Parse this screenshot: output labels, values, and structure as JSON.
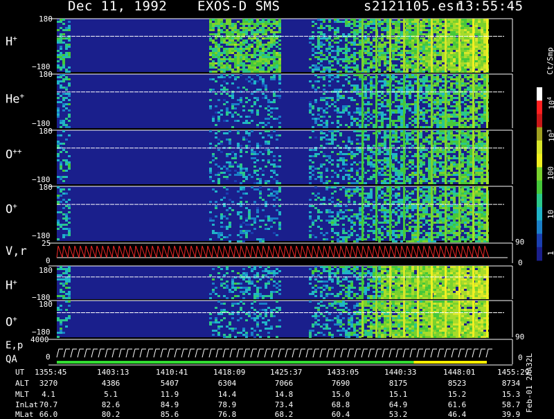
{
  "header": {
    "date": "Dec 11, 1992",
    "instrument": "EXOS-D SMS",
    "file": "s2121105.esr",
    "time": "13:55:45"
  },
  "colors": {
    "background": "#000000",
    "spectrogram_base": "#1a1f8c",
    "trace_line": "#ffffff",
    "velocity_line": "#ff2a2a",
    "qa_green": "#33dd33",
    "qa_yellow": "#ffee00"
  },
  "panels": [
    {
      "label_base": "H",
      "label_sup": "+",
      "ymax": "180",
      "ymin": "−180"
    },
    {
      "label_base": "He",
      "label_sup": "+",
      "ymax": "180",
      "ymin": "−180"
    },
    {
      "label_base": "O",
      "label_sup": "++",
      "ymax": "180",
      "ymin": "−180"
    },
    {
      "label_base": "O",
      "label_sup": "+",
      "ymax": "180",
      "ymin": "−180"
    },
    {
      "label_base": "V",
      "label_sup": "",
      "label_suffix": ",r",
      "ymax": "25",
      "ymin": "0",
      "right_top": "90",
      "right_bottom": "0"
    },
    {
      "label_base": "H",
      "label_sup": "+",
      "ymax": "180",
      "ymin": "−180"
    },
    {
      "label_base": "O",
      "label_sup": "+",
      "ymax": "180",
      "ymin": "−180",
      "right_bottom": "90"
    },
    {
      "label_base": "E,p",
      "label_line2": "QA",
      "ymax": "4000",
      "ymin": "0",
      "right_bottom": "0"
    }
  ],
  "colorbar": {
    "unit": "Ct/Smp",
    "labels": [
      "10",
      "10",
      "100",
      "10",
      "1"
    ],
    "exponents": [
      "4",
      "3",
      "",
      "",
      ""
    ]
  },
  "footer": {
    "row_labels": [
      "UT",
      "ALT",
      "MLT",
      "InLat",
      "MLat"
    ],
    "columns": [
      {
        "UT": "1355:45",
        "ALT": "3270",
        "MLT": "4.1",
        "InLat": "70.7",
        "MLat": "66.0"
      },
      {
        "UT": "1403:13",
        "ALT": "4386",
        "MLT": "5.1",
        "InLat": "82.6",
        "MLat": "80.2"
      },
      {
        "UT": "1410:41",
        "ALT": "5407",
        "MLT": "11.9",
        "InLat": "84.9",
        "MLat": "85.6"
      },
      {
        "UT": "1418:09",
        "ALT": "6304",
        "MLT": "14.4",
        "InLat": "78.9",
        "MLat": "76.8"
      },
      {
        "UT": "1425:37",
        "ALT": "7066",
        "MLT": "14.8",
        "InLat": "73.4",
        "MLat": "68.2"
      },
      {
        "UT": "1433:05",
        "ALT": "7690",
        "MLT": "15.0",
        "InLat": "68.8",
        "MLat": "60.4"
      },
      {
        "UT": "1440:33",
        "ALT": "8175",
        "MLT": "15.1",
        "InLat": "64.9",
        "MLat": "53.2"
      },
      {
        "UT": "1448:01",
        "ALT": "8523",
        "MLT": "15.2",
        "InLat": "61.6",
        "MLat": "46.4"
      },
      {
        "UT": "1455:29",
        "ALT": "8734",
        "MLT": "15.3",
        "InLat": "58.7",
        "MLat": "39.9"
      }
    ],
    "side_note": "Feb-01 2AA32L"
  },
  "chart_data": {
    "type": "heatmap",
    "title": "Dec 11, 1992   EXOS-D SMS",
    "x": [
      "1355:45",
      "1403:13",
      "1410:41",
      "1418:09",
      "1425:37",
      "1433:05",
      "1440:33",
      "1448:01",
      "1455:29"
    ],
    "xlabel": "UT",
    "series": [
      {
        "name": "H+",
        "ylim": [
          -180,
          180
        ]
      },
      {
        "name": "He+",
        "ylim": [
          -180,
          180
        ]
      },
      {
        "name": "O++",
        "ylim": [
          -180,
          180
        ]
      },
      {
        "name": "O+",
        "ylim": [
          -180,
          180
        ]
      },
      {
        "name": "V,r",
        "ylim": [
          0,
          25
        ]
      },
      {
        "name": "H+",
        "ylim": [
          -180,
          180
        ]
      },
      {
        "name": "O+",
        "ylim": [
          -180,
          180
        ]
      },
      {
        "name": "E,p QA",
        "ylim": [
          0,
          4000
        ]
      }
    ],
    "colorscale": {
      "unit": "Ct/Smp",
      "range": [
        1,
        10000
      ],
      "log": true
    }
  }
}
